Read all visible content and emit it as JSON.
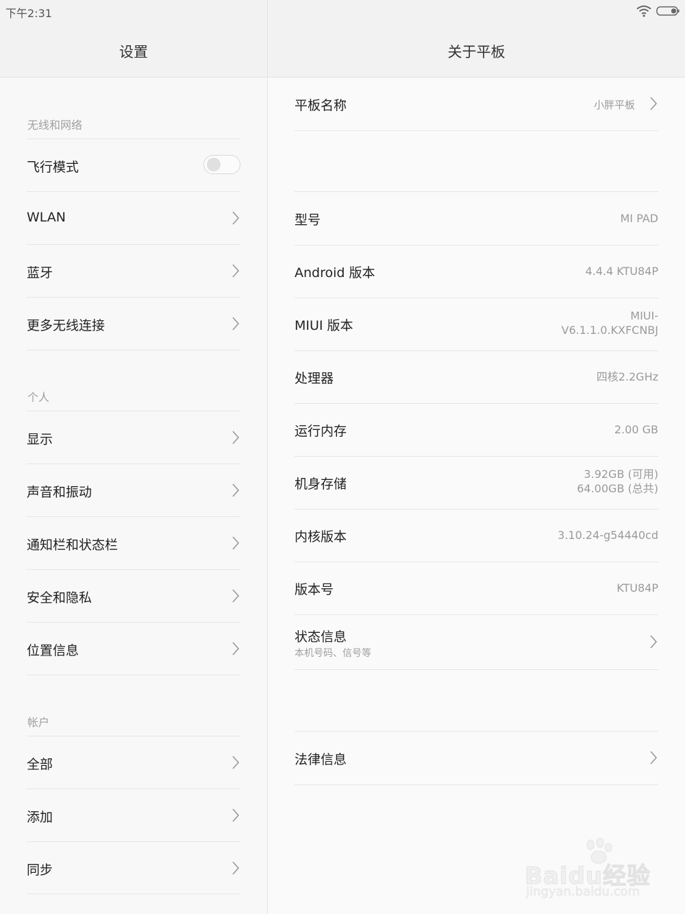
{
  "status_bar": {
    "time": "下午2:31"
  },
  "left_header": {
    "title": "设置"
  },
  "right_header": {
    "title": "关于平板"
  },
  "sections": {
    "wireless": {
      "label": "无线和网络",
      "items": [
        "飞行模式",
        "WLAN",
        "蓝牙",
        "更多无线连接"
      ]
    },
    "personal": {
      "label": "个人",
      "items": [
        "显示",
        "声音和振动",
        "通知栏和状态栏",
        "安全和隐私",
        "位置信息"
      ]
    },
    "accounts": {
      "label": "帐户",
      "items": [
        "全部",
        "添加",
        "同步"
      ]
    }
  },
  "airplane_mode": {
    "enabled": false
  },
  "about": {
    "device_name": {
      "label": "平板名称",
      "value": "小胖平板"
    },
    "model": {
      "label": "型号",
      "value": "MI PAD"
    },
    "android": {
      "label": "Android 版本",
      "value": "4.4.4 KTU84P"
    },
    "miui": {
      "label": "MIUI 版本",
      "value_line1": "MIUI-",
      "value_line2": "V6.1.1.0.KXFCNBJ"
    },
    "cpu": {
      "label": "处理器",
      "value": "四核2.2GHz"
    },
    "ram": {
      "label": "运行内存",
      "value": "2.00 GB"
    },
    "storage": {
      "label": "机身存储",
      "value_line1": "3.92GB (可用)",
      "value_line2": "64.00GB (总共)"
    },
    "kernel": {
      "label": "内核版本",
      "value": "3.10.24-g54440cd"
    },
    "build": {
      "label": "版本号",
      "value": "KTU84P"
    },
    "status": {
      "label": "状态信息",
      "sub": "本机号码、信号等"
    },
    "legal": {
      "label": "法律信息"
    }
  },
  "watermark": {
    "logo": "Baidu经验",
    "url": "jingyan.baidu.com"
  },
  "colors": {
    "background": "#f8f8f8",
    "header": "#f2f2f2",
    "divider": "#e6e6e6",
    "secondary_text": "#9a9a9a"
  },
  "icons": {
    "chevron": "chevron-right-icon",
    "wifi": "wifi-icon",
    "battery": "battery-icon"
  }
}
